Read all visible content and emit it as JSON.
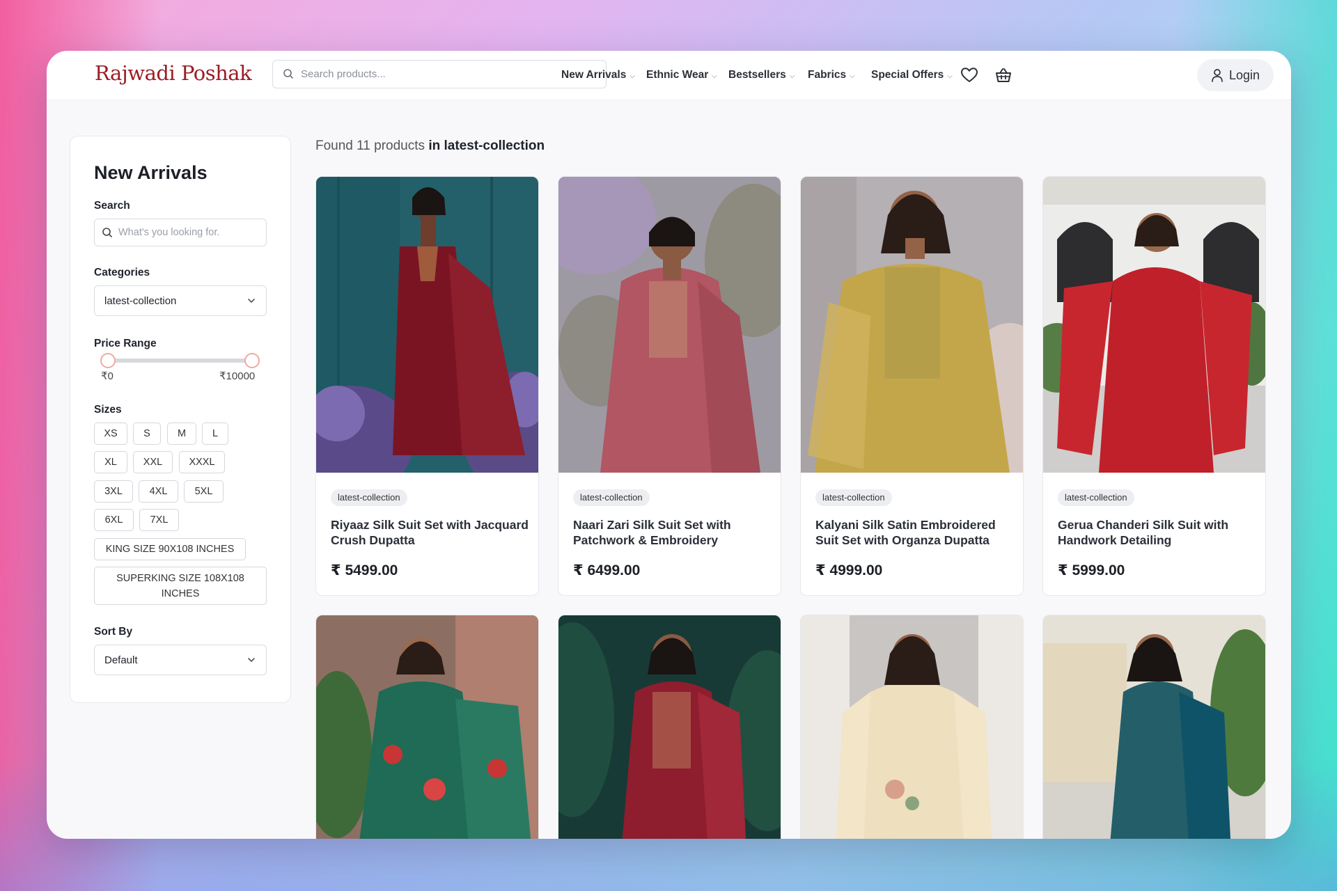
{
  "brand": {
    "logo_text": "Rajwadi Poshak",
    "accent": "#9b1c24"
  },
  "header": {
    "search_placeholder": "Search products...",
    "nav": [
      {
        "label": "New Arrivals"
      },
      {
        "label": "Ethnic Wear"
      },
      {
        "label": "Bestsellers"
      },
      {
        "label": "Fabrics"
      },
      {
        "label": "Special Offers"
      }
    ],
    "icons": [
      "heart-icon",
      "basket-icon",
      "user-icon"
    ],
    "login_label": "Login"
  },
  "sidebar": {
    "title": "New Arrivals",
    "search_label": "Search",
    "search_placeholder": "What's you looking for.",
    "categories_label": "Categories",
    "category_selected": "latest-collection",
    "price_label": "Price Range",
    "price_min": "₹0",
    "price_max": "₹10000",
    "sizes_label": "Sizes",
    "sizes": [
      "XS",
      "S",
      "M",
      "L",
      "XL",
      "XXL",
      "XXXL",
      "3XL",
      "4XL",
      "5XL",
      "6XL",
      "7XL",
      "KING SIZE 90X108 INCHES",
      "SUPERKING SIZE 108X108 INCHES"
    ],
    "sort_label": "Sort By",
    "sort_selected": "Default"
  },
  "results": {
    "prefix": "Found 11 products",
    "suffix": "in latest-collection"
  },
  "products": [
    {
      "tag": "latest-collection",
      "name": "Riyaaz Silk Suit Set with Jacquard Crush Dupatta",
      "price": "₹ 5499.00"
    },
    {
      "tag": "latest-collection",
      "name": "Naari Zari Silk Suit Set with Patchwork & Embroidery",
      "price": "₹ 6499.00"
    },
    {
      "tag": "latest-collection",
      "name": "Kalyani Silk Satin Embroidered Suit Set with Organza Dupatta",
      "price": "₹ 4999.00"
    },
    {
      "tag": "latest-collection",
      "name": "Gerua Chanderi Silk Suit with Handwork Detailing",
      "price": "₹ 5999.00"
    },
    {
      "tag": "",
      "name": "",
      "price": ""
    },
    {
      "tag": "",
      "name": "",
      "price": ""
    },
    {
      "tag": "",
      "name": "",
      "price": ""
    },
    {
      "tag": "",
      "name": "",
      "price": ""
    }
  ]
}
